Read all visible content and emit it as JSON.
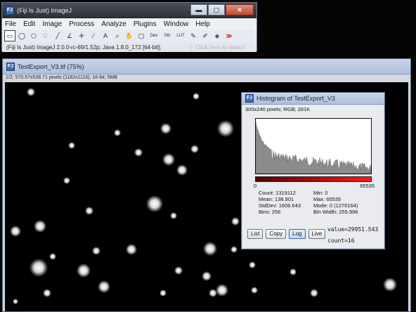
{
  "ij_main": {
    "title": "(Fiji Is Just) ImageJ",
    "menus": [
      "File",
      "Edit",
      "Image",
      "Process",
      "Analyze",
      "Plugins",
      "Window",
      "Help"
    ],
    "tools": [
      {
        "glyph": "▭",
        "name": "rectangle-tool-icon",
        "selected": true
      },
      {
        "glyph": "◯",
        "name": "oval-tool-icon"
      },
      {
        "glyph": "⬠",
        "name": "polygon-tool-icon"
      },
      {
        "glyph": "♡",
        "name": "freehand-tool-icon"
      },
      {
        "glyph": "╱",
        "name": "line-tool-icon"
      },
      {
        "glyph": "∠",
        "name": "angle-tool-icon"
      },
      {
        "glyph": "✛",
        "name": "point-tool-icon"
      },
      {
        "glyph": "⁄",
        "name": "wand-tool-icon"
      },
      {
        "glyph": "A",
        "name": "text-tool-icon"
      },
      {
        "glyph": "⌕",
        "name": "magnifier-tool-icon"
      },
      {
        "glyph": "✋",
        "name": "scroll-tool-icon"
      },
      {
        "glyph": "▢",
        "name": "color-picker-tool-icon"
      },
      {
        "glyph": "Dev",
        "name": "dev-tool-icon",
        "wide": true
      },
      {
        "glyph": "Stk",
        "name": "stack-tool-icon",
        "wide": true
      },
      {
        "glyph": "LUT",
        "name": "lut-tool-icon",
        "wide": true
      },
      {
        "glyph": "✎",
        "name": "pencil-tool-icon"
      },
      {
        "glyph": "✐",
        "name": "brush-tool-icon"
      },
      {
        "glyph": "◈",
        "name": "flood-fill-tool-icon"
      },
      {
        "glyph": "≫",
        "name": "more-tools-icon",
        "red": true
      }
    ],
    "status": "(Fiji Is Just) ImageJ 2.0.0-rc-69/1.52p; Java 1.8.0_172 [64-bit];",
    "search_placeholder": "Click here to search"
  },
  "image_window": {
    "title": "TestExport_V3.tif (75%)",
    "info": "1/2; 570.57x538.71 pixels (1182x1116); 16-bit; 5MB"
  },
  "histogram": {
    "title": "Histogram of TestExport_V3",
    "info": "300x240 pixels; RGB; 281K",
    "axis_min": "0",
    "axis_max": "65535",
    "stats": [
      [
        "Count: 1319112",
        "Min: 0"
      ],
      [
        "Mean: 138.901",
        "Max: 65535"
      ],
      [
        "StdDev: 1606.643",
        "Mode: 0 (1270164)"
      ],
      [
        "Bins: 256",
        "Bin Width: 255.996"
      ]
    ],
    "buttons": [
      "List",
      "Copy",
      "Log",
      "Live"
    ],
    "value_readout": "value=29951.543",
    "count_readout": "count=16"
  },
  "window_controls": {
    "minimize": "▬",
    "maximize": "▢",
    "close": "✕"
  }
}
